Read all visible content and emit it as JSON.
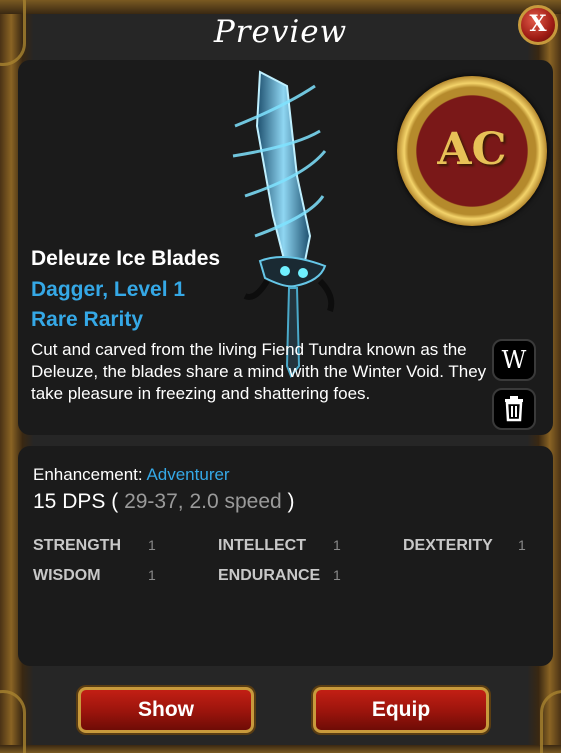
{
  "window": {
    "title": "Preview",
    "close_label": "X"
  },
  "logo": {
    "text": "AC"
  },
  "item": {
    "name": "Deleuze Ice Blades",
    "type_level": "Dagger, Level 1",
    "rarity": "Rare Rarity",
    "description": "Cut and carved from the living Fiend Tundra known as the Deleuze, the blades share a mind with the Winter Void. They take pleasure in freezing and shattering foes."
  },
  "actions": {
    "wiki_label": "W",
    "trash_icon": "trash-icon"
  },
  "stats": {
    "enhancement_label": "Enhancement:",
    "enhancement_value": "Adventurer",
    "dps_main": "15 DPS",
    "dps_open": "(",
    "dps_detail": "29-37, 2.0 speed",
    "dps_close": ")",
    "attributes": [
      {
        "label": "STRENGTH",
        "value": "1"
      },
      {
        "label": "INTELLECT",
        "value": "1"
      },
      {
        "label": "DEXTERITY",
        "value": "1"
      },
      {
        "label": "WISDOM",
        "value": "1"
      },
      {
        "label": "ENDURANCE",
        "value": "1"
      }
    ]
  },
  "buttons": {
    "show": "Show",
    "equip": "Equip"
  },
  "colors": {
    "accent_blue": "#35a8e6",
    "button_red": "#b01a10",
    "frame_gold": "#c89a3c"
  }
}
